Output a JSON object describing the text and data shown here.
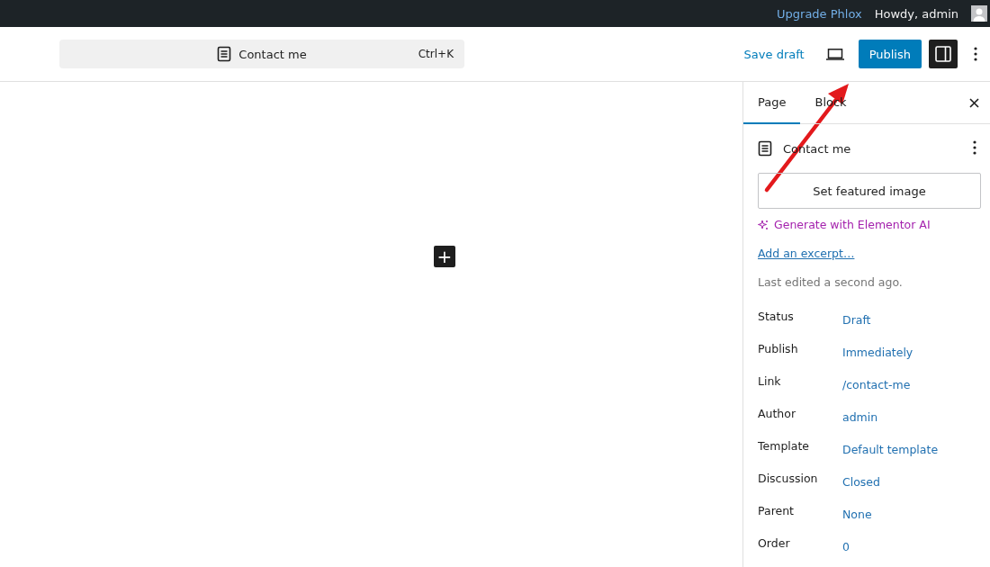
{
  "admin_bar": {
    "upgrade_link": "Upgrade Phlox",
    "greeting": "Howdy, admin"
  },
  "header": {
    "document_title": "Contact me",
    "shortcut": "Ctrl+K",
    "save_draft": "Save draft",
    "publish": "Publish",
    "settings_on": true
  },
  "canvas": {
    "add_block": "+"
  },
  "sidebar": {
    "tabs": [
      {
        "label": "Page",
        "selected": true
      },
      {
        "label": "Block",
        "selected": false
      }
    ],
    "page_title": "Contact me",
    "featured_image": "Set featured image",
    "ai_link": "Generate with Elementor AI",
    "excerpt_link": "Add an excerpt…",
    "last_edited": "Last edited a second ago.",
    "fields": [
      {
        "label": "Status",
        "value": "Draft"
      },
      {
        "label": "Publish",
        "value": "Immediately"
      },
      {
        "label": "Link",
        "value": "/contact-me"
      },
      {
        "label": "Author",
        "value": "admin"
      },
      {
        "label": "Template",
        "value": "Default template"
      },
      {
        "label": "Discussion",
        "value": "Closed"
      },
      {
        "label": "Parent",
        "value": "None"
      },
      {
        "label": "Order",
        "value": "0"
      }
    ]
  }
}
